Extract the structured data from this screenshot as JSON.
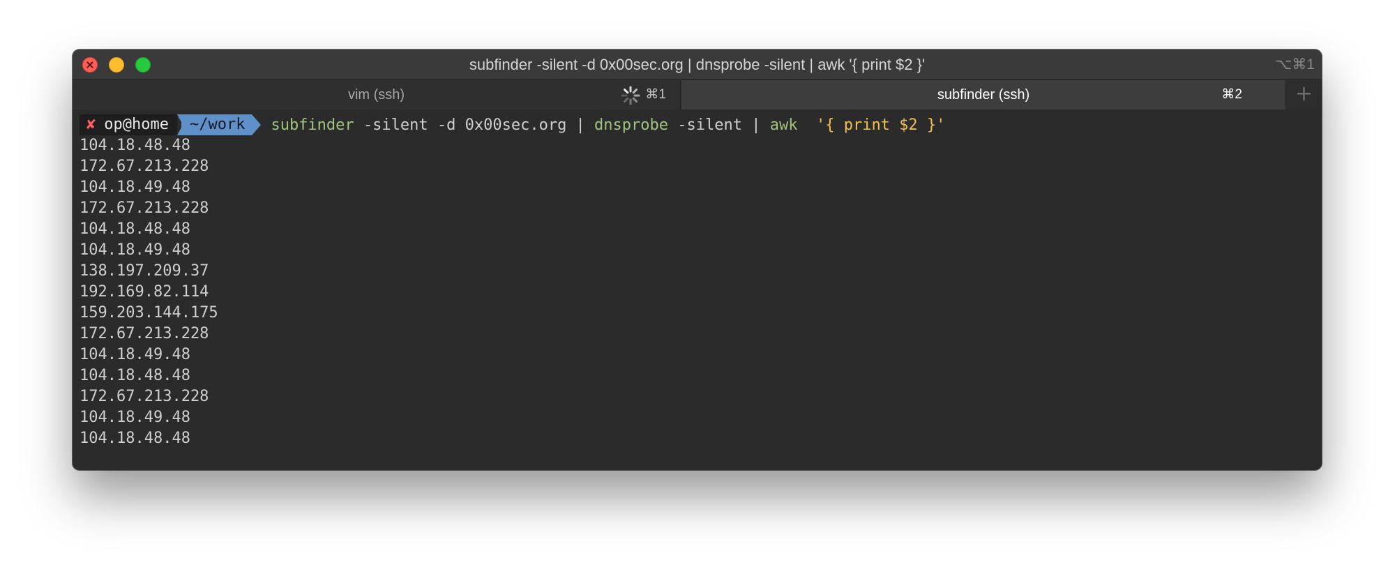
{
  "window": {
    "title": "subfinder -silent -d 0x00sec.org | dnsprobe -silent | awk '{ print $2 }'",
    "title_shortcut": "⌥⌘1",
    "colors": {
      "close": "#fe5f57",
      "minimize": "#febc2e",
      "maximize": "#28c840"
    }
  },
  "tabs": [
    {
      "label": "vim (ssh)",
      "shortcut": "⌘1",
      "active": false,
      "busy": true
    },
    {
      "label": "subfinder (ssh)",
      "shortcut": "⌘2",
      "active": true,
      "busy": false
    }
  ],
  "new_tab_icon": "plus-icon",
  "prompt": {
    "error_mark": "✘",
    "user_host": "op@home",
    "directory": "~/work",
    "command": {
      "prog1": "subfinder",
      "args1": " -silent -d 0x00sec.org | ",
      "prog2": "dnsprobe",
      "args2": " -silent | ",
      "prog3": "awk",
      "args3": "  ",
      "string": "'{ print $2 }'"
    }
  },
  "output_lines": [
    "104.18.48.48",
    "172.67.213.228",
    "104.18.49.48",
    "172.67.213.228",
    "104.18.48.48",
    "104.18.49.48",
    "138.197.209.37",
    "192.169.82.114",
    "159.203.144.175",
    "172.67.213.228",
    "104.18.49.48",
    "104.18.48.48",
    "172.67.213.228",
    "104.18.49.48",
    "104.18.48.48"
  ]
}
